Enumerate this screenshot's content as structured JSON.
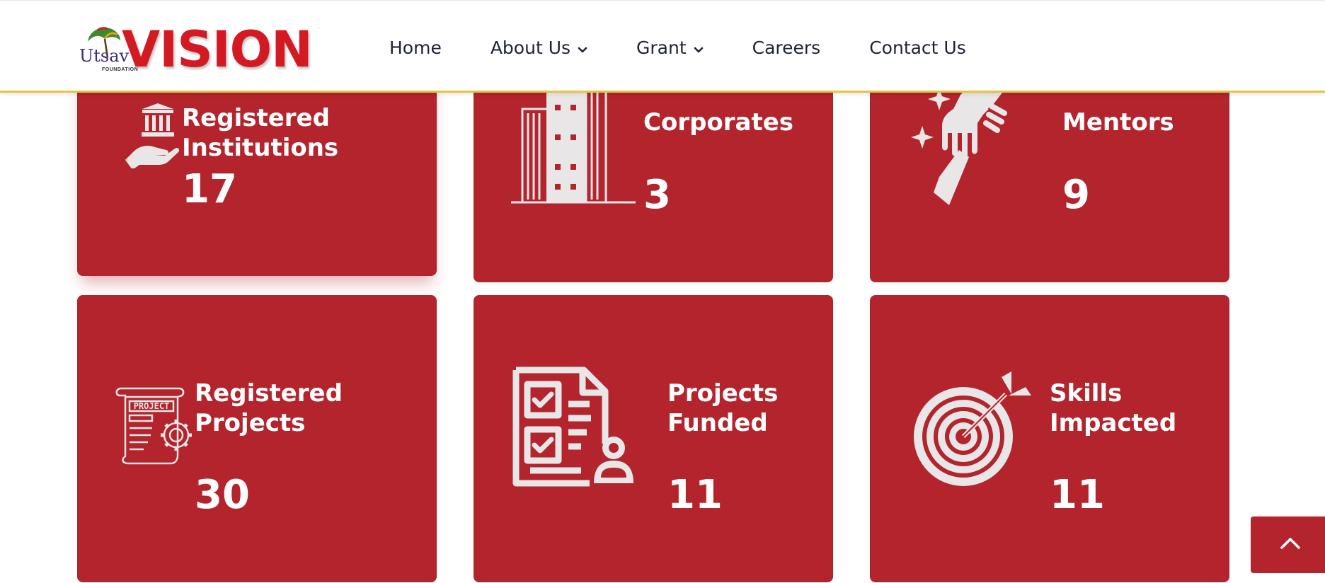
{
  "header": {
    "logo": {
      "small_text": "Utsav",
      "foundation_text": "FOUNDATION",
      "main_text": "VISION"
    },
    "nav": [
      {
        "label": "Home",
        "has_dropdown": false
      },
      {
        "label": "About Us",
        "has_dropdown": true
      },
      {
        "label": "Grant",
        "has_dropdown": true
      },
      {
        "label": "Careers",
        "has_dropdown": false
      },
      {
        "label": "Contact Us",
        "has_dropdown": false
      }
    ]
  },
  "stats": [
    {
      "label": "Registered\nInstitutions",
      "count": "17",
      "icon": "institution-hand-icon"
    },
    {
      "label": "Corporates",
      "count": "3",
      "icon": "buildings-icon"
    },
    {
      "label": "Mentors",
      "count": "9",
      "icon": "mentor-handshake-icon"
    },
    {
      "label": "Registered\nProjects",
      "count": "30",
      "icon": "project-scroll-icon"
    },
    {
      "label": "Projects\nFunded",
      "count": "11",
      "icon": "checklist-document-icon"
    },
    {
      "label": "Skills\nImpacted",
      "count": "11",
      "icon": "target-icon"
    }
  ],
  "back_to_top": {
    "icon": "chevron-up-icon"
  },
  "colors": {
    "card_red": "#b3242d",
    "logo_red": "#d31922",
    "header_border": "#e3c444",
    "icon_gray": "#e8e6e6",
    "nav_text": "#1e2333"
  }
}
